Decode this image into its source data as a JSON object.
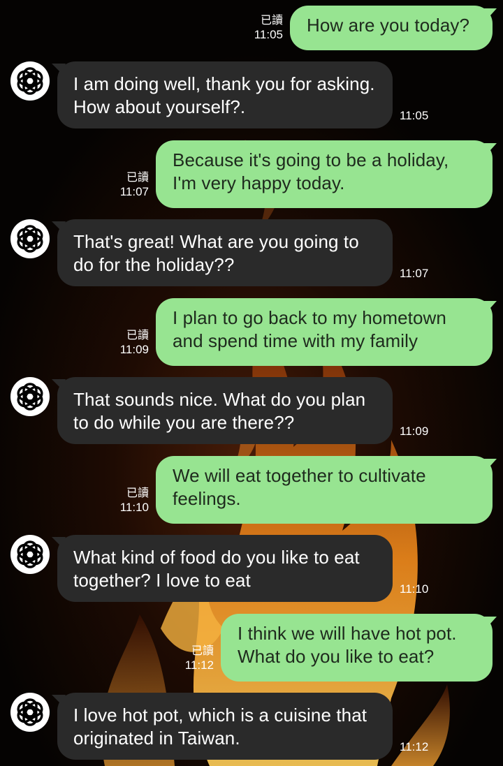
{
  "chat": {
    "read_label": "已讀",
    "colors": {
      "outgoing_bubble": "#97e491",
      "incoming_bubble": "#2a2a2a",
      "background": "#050302"
    },
    "avatar_icon": "openai-logo-icon",
    "messages": [
      {
        "direction": "outgoing",
        "text": "How are you today?",
        "time": "11:05",
        "read": "已讀"
      },
      {
        "direction": "incoming",
        "text": "I am doing well, thank you for asking. How about yourself?.",
        "time": "11:05"
      },
      {
        "direction": "outgoing",
        "text": "Because it's going to be a holiday, I'm very happy today.",
        "time": "11:07",
        "read": "已讀"
      },
      {
        "direction": "incoming",
        "text": "That's great! What are you going to do for the holiday??",
        "time": "11:07"
      },
      {
        "direction": "outgoing",
        "text": "I plan to go back to my hometown and spend time with my family",
        "time": "11:09",
        "read": "已讀"
      },
      {
        "direction": "incoming",
        "text": "That sounds nice. What do you plan to do while you are there??",
        "time": "11:09"
      },
      {
        "direction": "outgoing",
        "text": "We will eat together to cultivate feelings.",
        "time": "11:10",
        "read": "已讀"
      },
      {
        "direction": "incoming",
        "text": "What kind of food do you like to eat together? I love to eat",
        "time": "11:10"
      },
      {
        "direction": "outgoing",
        "text": "I think we will have hot pot. What do you like to eat?",
        "time": "11:12",
        "read": "已讀"
      },
      {
        "direction": "incoming",
        "text": "I love hot pot, which is a cuisine that originated in Taiwan.",
        "time": "11:12"
      }
    ]
  }
}
